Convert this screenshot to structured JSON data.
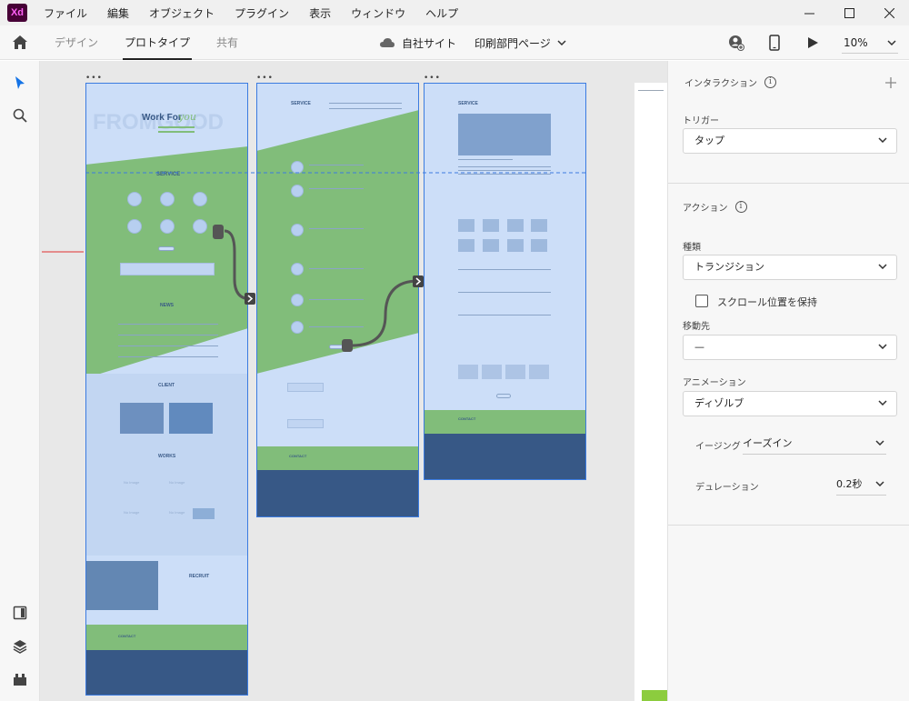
{
  "app": {
    "logo": "Xd"
  },
  "menu": [
    "ファイル",
    "編集",
    "オブジェクト",
    "プラグイン",
    "表示",
    "ウィンドウ",
    "ヘルプ"
  ],
  "tabs": [
    {
      "label": "デザイン",
      "active": false
    },
    {
      "label": "プロトタイプ",
      "active": true
    },
    {
      "label": "共有",
      "active": false
    }
  ],
  "document": {
    "project": "自社サイト",
    "page": "印刷部門ページ"
  },
  "zoom": "10%",
  "artboards": {
    "a1": {
      "hero_title": "Work For",
      "hero_script": "you",
      "hero_bg": "FROMGOOD",
      "service": "SERVICE",
      "news": "NEWS",
      "client": "CLIENT",
      "works": "WORKS",
      "recruit": "RECRUIT",
      "contact": "CONTACT",
      "no_image": "No Image"
    },
    "a2": {
      "service": "SERVICE",
      "contact": "CONTACT"
    },
    "a3": {
      "service": "SERVICE",
      "contact": "CONTACT"
    }
  },
  "panel": {
    "interaction_title": "インタラクション",
    "trigger_label": "トリガー",
    "trigger_value": "タップ",
    "action_title": "アクション",
    "type_label": "種類",
    "type_value": "トランジション",
    "preserve_scroll": "スクロール位置を保持",
    "destination_label": "移動先",
    "destination_value": "—",
    "animation_label": "アニメーション",
    "animation_value": "ディゾルブ",
    "easing_label": "イージング",
    "easing_value": "イーズイン",
    "duration_label": "デュレーション",
    "duration_value": "0.2秒"
  },
  "colors": {
    "accent": "#1473e6",
    "green": "#8ccc3e",
    "navy": "#1b3250",
    "selection": "#3b7be0"
  }
}
